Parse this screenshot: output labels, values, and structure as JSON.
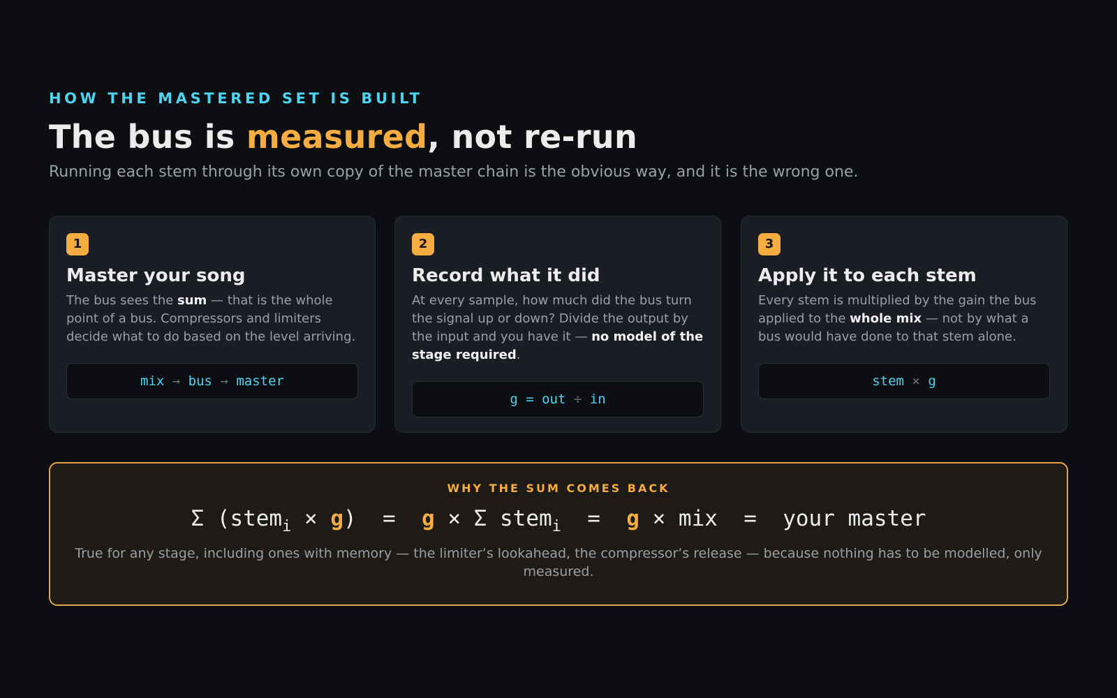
{
  "header": {
    "eyebrow": "HOW THE MASTERED SET IS BUILT",
    "title_pre": "The bus is ",
    "title_accent": "measured",
    "title_post": ", not re-run",
    "subtitle": "Running each stem through its own copy of the master chain is the obvious way, and it is the wrong one."
  },
  "steps": [
    {
      "number": "1",
      "title": "Master your song",
      "text": [
        {
          "t": "The bus sees the "
        },
        {
          "t": "sum",
          "bold": true
        },
        {
          "t": " — that is the whole point of a bus. Compressors and limiters decide what to do based on the level arriving."
        }
      ],
      "code": [
        {
          "t": "mix"
        },
        {
          "t": " → ",
          "op": true
        },
        {
          "t": "bus"
        },
        {
          "t": " → ",
          "op": true
        },
        {
          "t": "master"
        }
      ]
    },
    {
      "number": "2",
      "title": "Record what it did",
      "text": [
        {
          "t": "At every sample, how much did the bus turn the signal up or down? Divide the output by the input and you have it — "
        },
        {
          "t": "no model of the stage required",
          "bold": true
        },
        {
          "t": "."
        }
      ],
      "code": [
        {
          "t": "g"
        },
        {
          "t": " = ",
          "op": false
        },
        {
          "t": "out"
        },
        {
          "t": " ÷ ",
          "op": true
        },
        {
          "t": "in"
        }
      ]
    },
    {
      "number": "3",
      "title": "Apply it to each stem",
      "text": [
        {
          "t": "Every stem is multiplied by the gain the bus applied to the "
        },
        {
          "t": "whole mix",
          "bold": true
        },
        {
          "t": " — not by what a bus would have done to that stem alone."
        }
      ],
      "code": [
        {
          "t": "stem"
        },
        {
          "t": " × ",
          "op": true
        },
        {
          "t": "g"
        }
      ]
    }
  ],
  "why": {
    "title": "WHY THE SUM COMES BACK",
    "formula": [
      {
        "t": "Σ (stem"
      },
      {
        "t": "i",
        "sub": true
      },
      {
        "t": " × "
      },
      {
        "t": "g",
        "g": true
      },
      {
        "t": ")  =  "
      },
      {
        "t": "g",
        "g": true
      },
      {
        "t": " × Σ stem"
      },
      {
        "t": "i",
        "sub": true
      },
      {
        "t": "  =  "
      },
      {
        "t": "g",
        "g": true
      },
      {
        "t": " × mix  =  your master"
      }
    ],
    "note": "True for any stage, including ones with memory — the limiter’s lookahead, the compressor’s release — because nothing has to be modelled, only measured."
  },
  "colors": {
    "background": "#0c0e12",
    "accent": "#f5ac40",
    "cyan": "#4fd4f0",
    "card": "#1a1d24"
  }
}
